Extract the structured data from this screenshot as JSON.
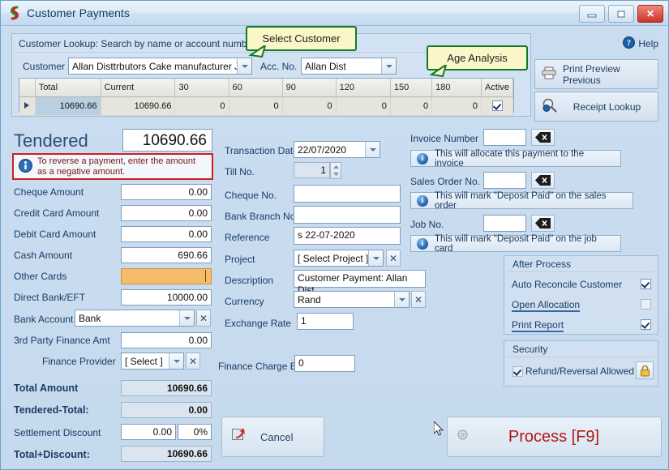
{
  "window": {
    "title": "Customer Payments",
    "icon": "app-swirl-icon",
    "minimize": "–",
    "maximize": "□",
    "close": "✕"
  },
  "help": {
    "label": "Help",
    "icon": "help-question-icon"
  },
  "callouts": [
    {
      "text": "Select Customer",
      "name": "callout-select-customer"
    },
    {
      "text": "Age Analysis",
      "name": "callout-age-analysis"
    }
  ],
  "lookup": {
    "title": "Customer Lookup: Search by name or account number",
    "customer_label": "Customer",
    "customer_value": "Allan Disttrbutors Cake manufacturer J",
    "accno_label": "Acc. No.",
    "accno_value": "Allan Dist"
  },
  "age_grid": {
    "columns": [
      "Total",
      "Current",
      "30",
      "60",
      "90",
      "120",
      "150",
      "180",
      "Active"
    ],
    "row": {
      "marker": "▶",
      "values": [
        "10690.66",
        "10690.66",
        "0",
        "0",
        "0",
        "0",
        "0",
        "0"
      ],
      "active": true
    }
  },
  "side_buttons": [
    {
      "label": "Print Preview Previous",
      "icon": "printer-icon",
      "name": "print-preview-previous-button"
    },
    {
      "label": "Receipt Lookup",
      "icon": "magnifier-icon",
      "name": "receipt-lookup-button"
    }
  ],
  "tendered": {
    "label": "Tendered",
    "value": "10690.66"
  },
  "warning": {
    "icon": "info-icon",
    "line1": "To reverse a payment, enter the amount",
    "line2": "as a negative amount."
  },
  "left_fields": [
    {
      "label": "Cheque Amount",
      "value": "0.00",
      "name": "cheque-amount"
    },
    {
      "label": "Credit Card Amount",
      "value": "0.00",
      "name": "credit-card-amount"
    },
    {
      "label": "Debit Card Amount",
      "value": "0.00",
      "name": "debit-card-amount"
    },
    {
      "label": "Cash Amount",
      "value": "690.66",
      "name": "cash-amount"
    },
    {
      "label": "Other Cards",
      "value": "",
      "name": "other-cards",
      "highlight": true
    },
    {
      "label": "Direct Bank/EFT",
      "value": "10000.00",
      "name": "direct-bank-eft"
    }
  ],
  "bank_account": {
    "label": "Bank Account",
    "value": "Bank"
  },
  "third_party": {
    "label": "3rd Party Finance Amt",
    "value": "0.00"
  },
  "finance_provider": {
    "label": "Finance Provider",
    "value": "[ Select ]"
  },
  "totals": [
    {
      "label": "Total Amount",
      "value": "10690.66",
      "name": "total-amount",
      "bold": true
    },
    {
      "label": "Tendered-Total:",
      "value": "0.00",
      "name": "tendered-total",
      "bold": true
    },
    {
      "label": "Total+Discount:",
      "value": "10690.66",
      "name": "total-plus-discount",
      "bold": true
    }
  ],
  "settlement": {
    "label": "Settlement Discount",
    "amount": "0.00",
    "percent": "0%"
  },
  "middle": {
    "transaction_date": {
      "label": "Transaction Date",
      "value": "22/07/2020"
    },
    "till_no": {
      "label": "Till No.",
      "value": "1"
    },
    "cheque_no": {
      "label": "Cheque No.",
      "value": ""
    },
    "bank_branch_no": {
      "label": "Bank Branch No.",
      "value": ""
    },
    "reference": {
      "label": "Reference",
      "value": "s 22-07-2020"
    },
    "project": {
      "label": "Project",
      "value": "[ Select Project ]"
    },
    "description": {
      "label": "Description",
      "value": "Customer Payment: Allan Dist"
    },
    "currency": {
      "label": "Currency",
      "value": "Rand"
    },
    "exchange_rate": {
      "label": "Exchange Rate",
      "value": "1"
    },
    "finance_charge": {
      "label": "Finance Charge Excl",
      "value": "0"
    }
  },
  "right": {
    "invoice": {
      "label": "Invoice Number",
      "value": "",
      "clear_icon": "clear-backspace-icon"
    },
    "invoice_info": "This will allocate this payment to the invoice",
    "sales_order": {
      "label": "Sales Order No.",
      "value": "",
      "clear_icon": "clear-backspace-icon"
    },
    "sales_order_info": "This will mark \"Deposit Paid\" on the sales order",
    "job": {
      "label": "Job No.",
      "value": "",
      "clear_icon": "clear-backspace-icon"
    },
    "job_info": "This will mark \"Deposit Paid\" on the job card"
  },
  "after_process": {
    "title": "After Process",
    "items": [
      {
        "label": "Auto Reconcile Customer",
        "checked": true,
        "accel": false
      },
      {
        "label": "Open Allocation",
        "checked": false,
        "accel": true
      },
      {
        "label": "Print Report",
        "checked": true,
        "accel": true
      }
    ]
  },
  "security": {
    "title": "Security",
    "label": "Refund/Reversal Allowed",
    "checked": true,
    "icon": "padlock-icon"
  },
  "buttons": {
    "cancel": {
      "label": "Cancel",
      "icon": "cancel-icon"
    },
    "process": {
      "label": "Process [F9]",
      "icon": "gear-icon"
    }
  },
  "colors": {
    "accent": "#1b3c63",
    "warning_border": "#cc2020",
    "process_text": "#b01818",
    "highlight_field": "#f5bd6a",
    "callout_fill": "#fbf6c8",
    "callout_border": "#0f7a2e"
  }
}
